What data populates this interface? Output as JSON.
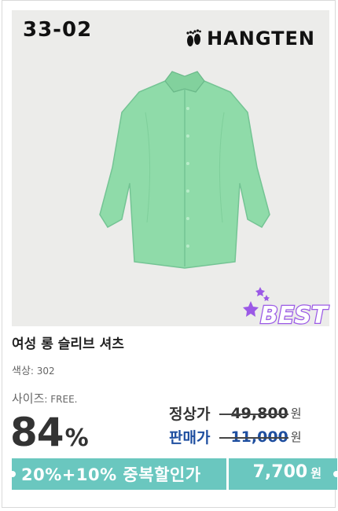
{
  "product": {
    "code": "33-02",
    "brand": "HANGTEN",
    "badge": "BEST",
    "title": "여성 롱 슬리브 셔츠",
    "color_label": "색상",
    "color_value": ": 302",
    "size_label": "사이즈",
    "size_value": ": FREE.",
    "discount_number": "84",
    "discount_symbol": "%",
    "regular_price_label": "정상가",
    "regular_price": "49,800",
    "sale_price_label": "판매가",
    "sale_price": "11,000",
    "currency": "원",
    "coupon_text": "20%+10% 중복할인가",
    "final_price": "7,700",
    "final_currency": "원"
  },
  "colors": {
    "shirt": "#8fdba9",
    "coupon_bar": "#6ac7bf",
    "sale_price": "#1f4fa0",
    "badge": "#9b59e6"
  }
}
